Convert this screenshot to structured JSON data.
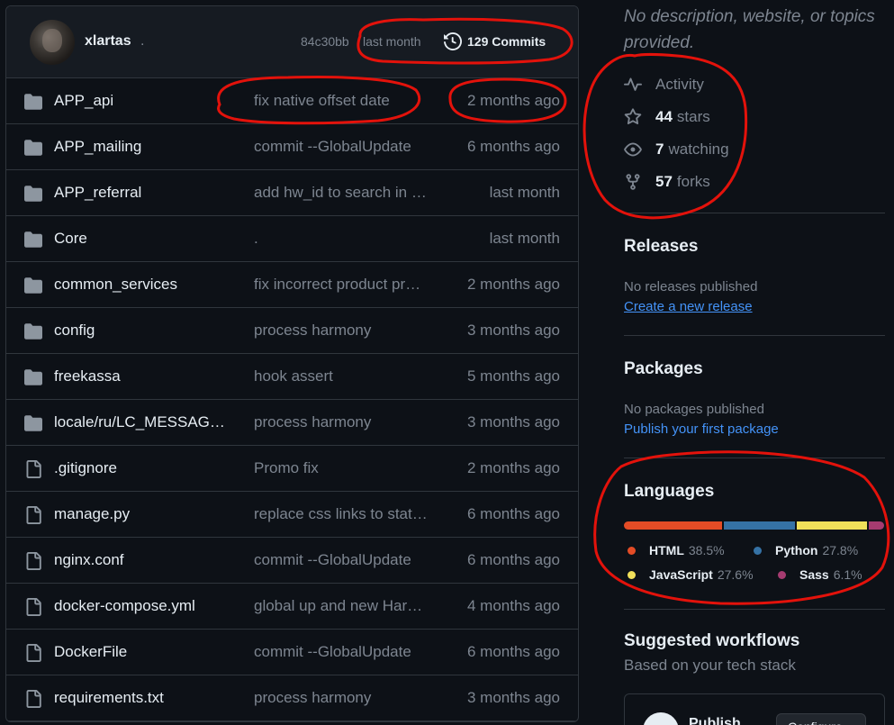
{
  "commit": {
    "author": "xlartas",
    "author_suffix": ".",
    "sha": "84c30bb",
    "time": "last month",
    "commits_label": "129 Commits",
    "history_icon": "history-icon"
  },
  "files": [
    {
      "type": "dir",
      "name": "APP_api",
      "message": "fix native offset date",
      "date": "2 months ago"
    },
    {
      "type": "dir",
      "name": "APP_mailing",
      "message": "commit --GlobalUpdate",
      "date": "6 months ago"
    },
    {
      "type": "dir",
      "name": "APP_referral",
      "message": "add hw_id to search in …",
      "date": "last month"
    },
    {
      "type": "dir",
      "name": "Core",
      "message": ".",
      "date": "last month"
    },
    {
      "type": "dir",
      "name": "common_services",
      "message": "fix incorrect product pr…",
      "date": "2 months ago"
    },
    {
      "type": "dir",
      "name": "config",
      "message": "process harmony",
      "date": "3 months ago"
    },
    {
      "type": "dir",
      "name": "freekassa",
      "message": "hook assert",
      "date": "5 months ago"
    },
    {
      "type": "dir",
      "name": "locale/ru/LC_MESSAG…",
      "message": "process harmony",
      "date": "3 months ago"
    },
    {
      "type": "file",
      "name": ".gitignore",
      "message": "Promo fix",
      "date": "2 months ago"
    },
    {
      "type": "file",
      "name": "manage.py",
      "message": "replace css links to stat…",
      "date": "6 months ago"
    },
    {
      "type": "file",
      "name": "nginx.conf",
      "message": "commit --GlobalUpdate",
      "date": "6 months ago"
    },
    {
      "type": "file",
      "name": "docker-compose.yml",
      "message": "global up and new Har…",
      "date": "4 months ago"
    },
    {
      "type": "file",
      "name": "DockerFile",
      "message": "commit --GlobalUpdate",
      "date": "6 months ago"
    },
    {
      "type": "file",
      "name": "requirements.txt",
      "message": "process harmony",
      "date": "3 months ago"
    }
  ],
  "about": {
    "description": "No description, website, or topics provided.",
    "activity": "Activity",
    "stars_count": "44",
    "stars_label": "stars",
    "watching_count": "7",
    "watching_label": "watching",
    "forks_count": "57",
    "forks_label": "forks"
  },
  "releases": {
    "title": "Releases",
    "note": "No releases published",
    "link": "Create a new release"
  },
  "packages": {
    "title": "Packages",
    "note": "No packages published",
    "link": "Publish your first package"
  },
  "languages": {
    "title": "Languages",
    "items": [
      {
        "name": "HTML",
        "percent": "38.5%",
        "value": 38.5,
        "color": "#e34c26"
      },
      {
        "name": "Python",
        "percent": "27.8%",
        "value": 27.8,
        "color": "#3572A5"
      },
      {
        "name": "JavaScript",
        "percent": "27.6%",
        "value": 27.6,
        "color": "#f1e05a"
      },
      {
        "name": "Sass",
        "percent": "6.1%",
        "value": 6.1,
        "color": "#a53b70"
      }
    ]
  },
  "workflows": {
    "title": "Suggested workflows",
    "subtitle": "Based on your tech stack",
    "card_name": "Publish",
    "card_button": "Configure"
  }
}
